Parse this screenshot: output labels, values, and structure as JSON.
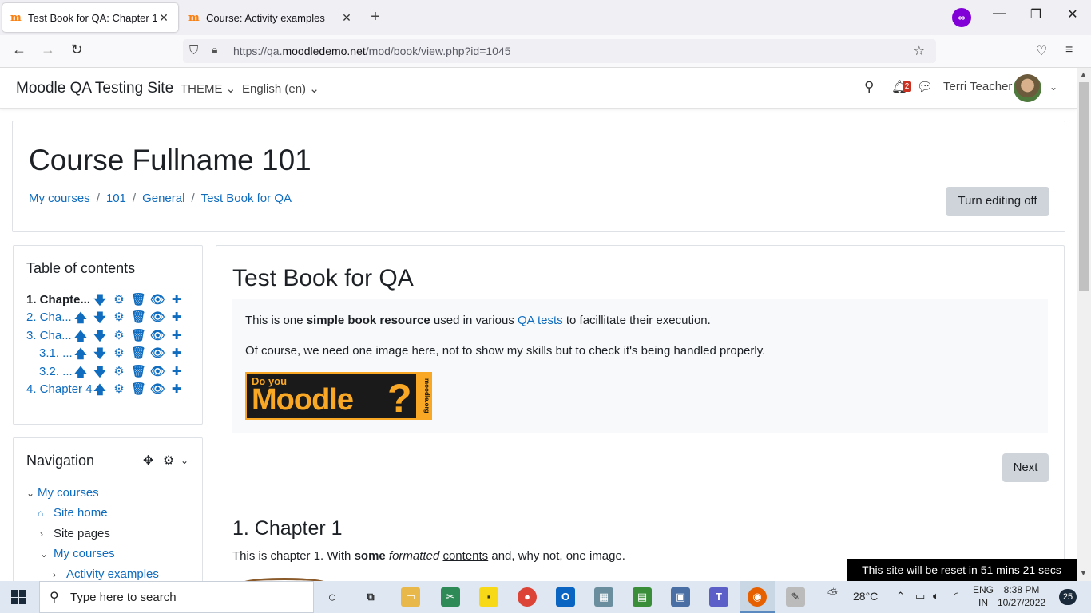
{
  "browser": {
    "tabs": [
      {
        "title": "Test Book for QA: Chapter 1",
        "active": true
      },
      {
        "title": "Course: Activity examples",
        "active": false
      }
    ],
    "url_prefix": "https://qa.",
    "url_domain": "moodledemo.net",
    "url_path": "/mod/book/view.php?id=1045"
  },
  "header": {
    "site_name": "Moodle QA Testing Site",
    "theme_menu": "THEME",
    "language_menu": "English (en)",
    "notification_count": "2",
    "user_name": "Terri Teacher"
  },
  "page_header": {
    "course_title": "Course Fullname 101",
    "breadcrumb": [
      "My courses",
      "101",
      "General",
      "Test Book for QA"
    ],
    "edit_button": "Turn editing off"
  },
  "toc": {
    "title": "Table of contents",
    "items": [
      {
        "label": "1. Chapte...",
        "current": true
      },
      {
        "label": "2. Cha..."
      },
      {
        "label": "3. Cha..."
      },
      {
        "label": "3.1. ..."
      },
      {
        "label": "3.2. ..."
      },
      {
        "label": "4. Chapter 4"
      }
    ]
  },
  "navigation": {
    "title": "Navigation",
    "items": [
      {
        "label": "My courses"
      },
      {
        "label": "Site home"
      },
      {
        "label": "Site pages"
      },
      {
        "label": "My courses"
      },
      {
        "label": "Activity examples"
      }
    ]
  },
  "main": {
    "book_title": "Test Book for QA",
    "intro_1_pre": "This is one ",
    "intro_1_bold": "simple book resource",
    "intro_1_mid": " used in various ",
    "intro_1_link": "QA tests",
    "intro_1_post": " to facillitate their execution.",
    "intro_2": "Of course, we need one image here, not to show my skills but to check it's being handled properly.",
    "image_text_small": "Do you",
    "image_text_big": "Moodle",
    "image_text_q": "?",
    "image_text_side": "moodle.org",
    "next_button": "Next",
    "chapter_title": "1. Chapter 1",
    "chapter_pre": "This is chapter 1. With ",
    "chapter_bold": "some",
    "chapter_italic": "formatted",
    "chapter_under": "contents",
    "chapter_post": " and, why not, one image."
  },
  "toast": "This site will be reset in 51 mins 21 secs",
  "taskbar": {
    "search_placeholder": "Type here to search",
    "weather": "28°C",
    "lang_1": "ENG",
    "lang_2": "IN",
    "time": "8:38 PM",
    "date": "10/27/2022",
    "notifications": "25"
  }
}
